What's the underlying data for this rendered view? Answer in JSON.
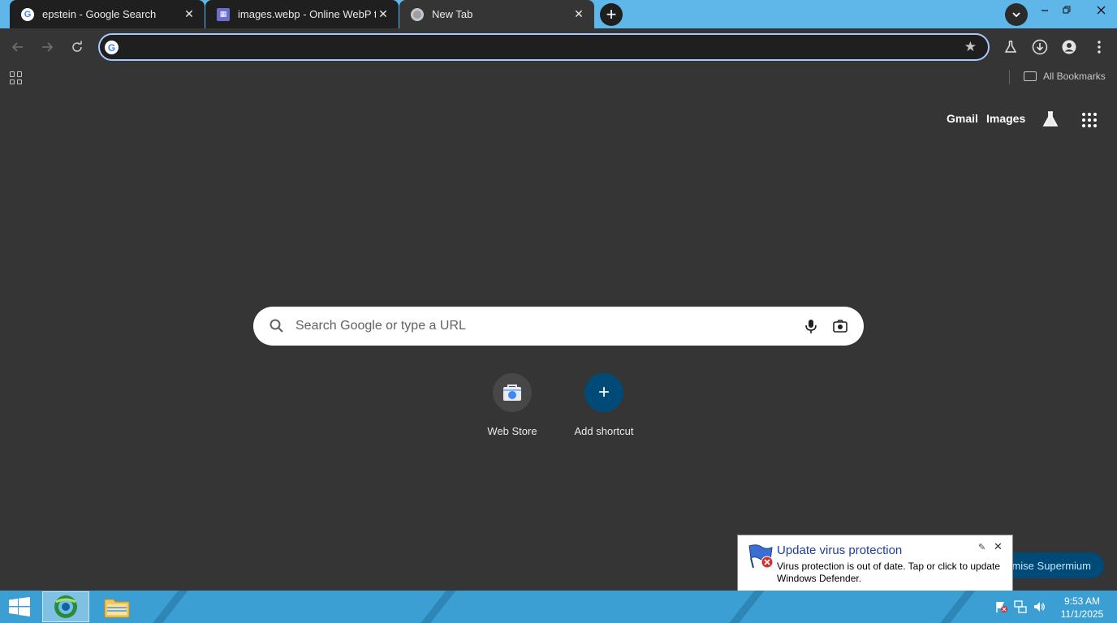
{
  "browser": {
    "tabs": [
      {
        "title": "epstein - Google Search",
        "favicon": "google-g-icon"
      },
      {
        "title": "images.webp - Online WebP to",
        "favicon": "webp-converter-icon"
      },
      {
        "title": "New Tab",
        "favicon": "chrome-icon"
      }
    ],
    "new_tab_symbol": "+",
    "close_symbol": "✕",
    "omnibox_value": "",
    "all_bookmarks_label": "All Bookmarks"
  },
  "ntp": {
    "top_links": {
      "gmail": "Gmail",
      "images": "Images"
    },
    "search_placeholder": "Search Google or type a URL",
    "shortcuts": [
      {
        "label": "Web Store",
        "icon": "web-store-icon"
      },
      {
        "label": "Add shortcut",
        "icon": "plus-icon",
        "symbol": "+"
      }
    ],
    "customise_label": "mise Supermium"
  },
  "notification": {
    "title": "Update virus protection",
    "body": "Virus protection is out of date. Tap or click to update Windows Defender.",
    "close_symbol": "✕"
  },
  "taskbar": {
    "time": "9:53 AM",
    "date": "11/1/2025"
  },
  "colors": {
    "tabstrip": "#5fb6e8",
    "toolbar": "#353535",
    "omnibox_focus": "#a8c7fa",
    "taskbar": "#3c9fd3",
    "toast_title": "#1e3f9a"
  }
}
